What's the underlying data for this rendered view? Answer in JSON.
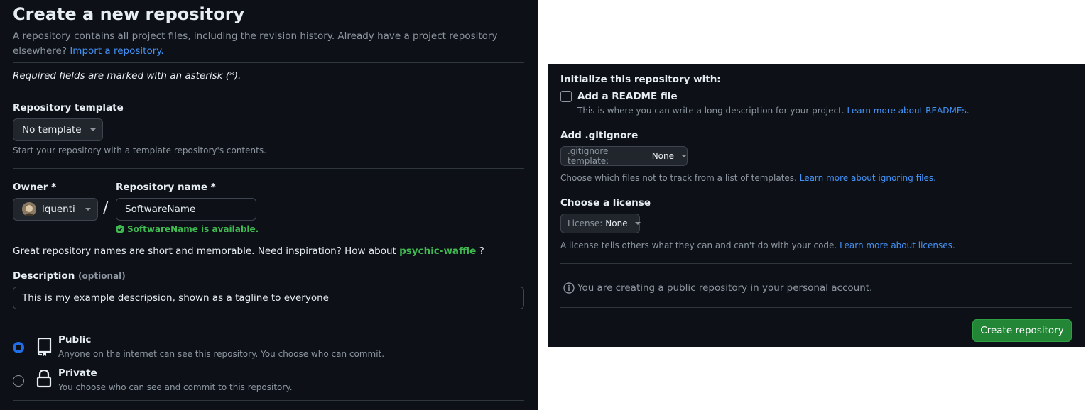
{
  "page": {
    "title": "Create a new repository",
    "intro": "A repository contains all project files, including the revision history. Already have a project repository",
    "intro_line2": "elsewhere?",
    "import_link": "Import a repository.",
    "required_note": "Required fields are marked with an asterisk (*)."
  },
  "template": {
    "label": "Repository template",
    "button": "No template",
    "help": "Start your repository with a template repository's contents."
  },
  "owner": {
    "label": "Owner *",
    "value": "lquenti",
    "separator": "/"
  },
  "repo_name": {
    "label": "Repository name *",
    "value": "SoftwareName",
    "availability": "SoftwareName is available."
  },
  "suggestion": {
    "text": "Great repository names are short and memorable. Need inspiration? How about",
    "name": "psychic-waffle",
    "suffix": "?"
  },
  "description": {
    "label": "Description",
    "optional": "(optional)",
    "value": "This is my example descripsion, shown as a tagline to everyone"
  },
  "visibility": {
    "options": [
      {
        "title": "Public",
        "desc": "Anyone on the internet can see this repository. You choose who can commit.",
        "selected": true
      },
      {
        "title": "Private",
        "desc": "You choose who can see and commit to this repository.",
        "selected": false
      }
    ]
  },
  "init": {
    "heading": "Initialize this repository with:",
    "readme_label": "Add a README file",
    "readme_desc": "This is where you can write a long description for your project.",
    "readme_link": "Learn more about READMEs.",
    "readme_checked": false
  },
  "gitignore": {
    "label": "Add .gitignore",
    "button_prefix": ".gitignore template:",
    "button_value": "None",
    "help": "Choose which files not to track from a list of templates.",
    "help_link": "Learn more about ignoring files."
  },
  "license": {
    "label": "Choose a license",
    "button_prefix": "License:",
    "button_value": "None",
    "help": "A license tells others what they can and can't do with your code.",
    "help_link": "Learn more about licenses."
  },
  "notice": {
    "text": "You are creating a public repository in your personal account."
  },
  "submit": {
    "label": "Create repository"
  },
  "colors": {
    "background": "#0d1117",
    "accent_blue": "#4493f8",
    "success_green": "#3fb950",
    "primary_button": "#238636"
  },
  "icons": [
    "caret-down-icon",
    "avatar",
    "check-circle-icon",
    "repo-icon",
    "lock-icon",
    "info-icon"
  ]
}
